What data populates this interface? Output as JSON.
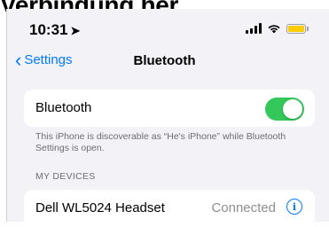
{
  "caption": "Verbindung her.",
  "status": {
    "time": "10:31",
    "location_glyph": "➤"
  },
  "nav": {
    "back_label": "Settings",
    "title": "Bluetooth"
  },
  "bluetooth": {
    "label": "Bluetooth",
    "toggle_on": true,
    "note": "This iPhone is discoverable as “He's iPhone” while Bluetooth Settings is open."
  },
  "my_devices": {
    "header": "MY DEVICES",
    "devices": [
      {
        "name": "Dell WL5024 Headset",
        "status": "Connected",
        "info_glyph": "i"
      }
    ]
  },
  "colors": {
    "accent": "#007aff",
    "toggle_on": "#34c759",
    "battery": "#ffcc00",
    "background": "#f2f2f7"
  }
}
